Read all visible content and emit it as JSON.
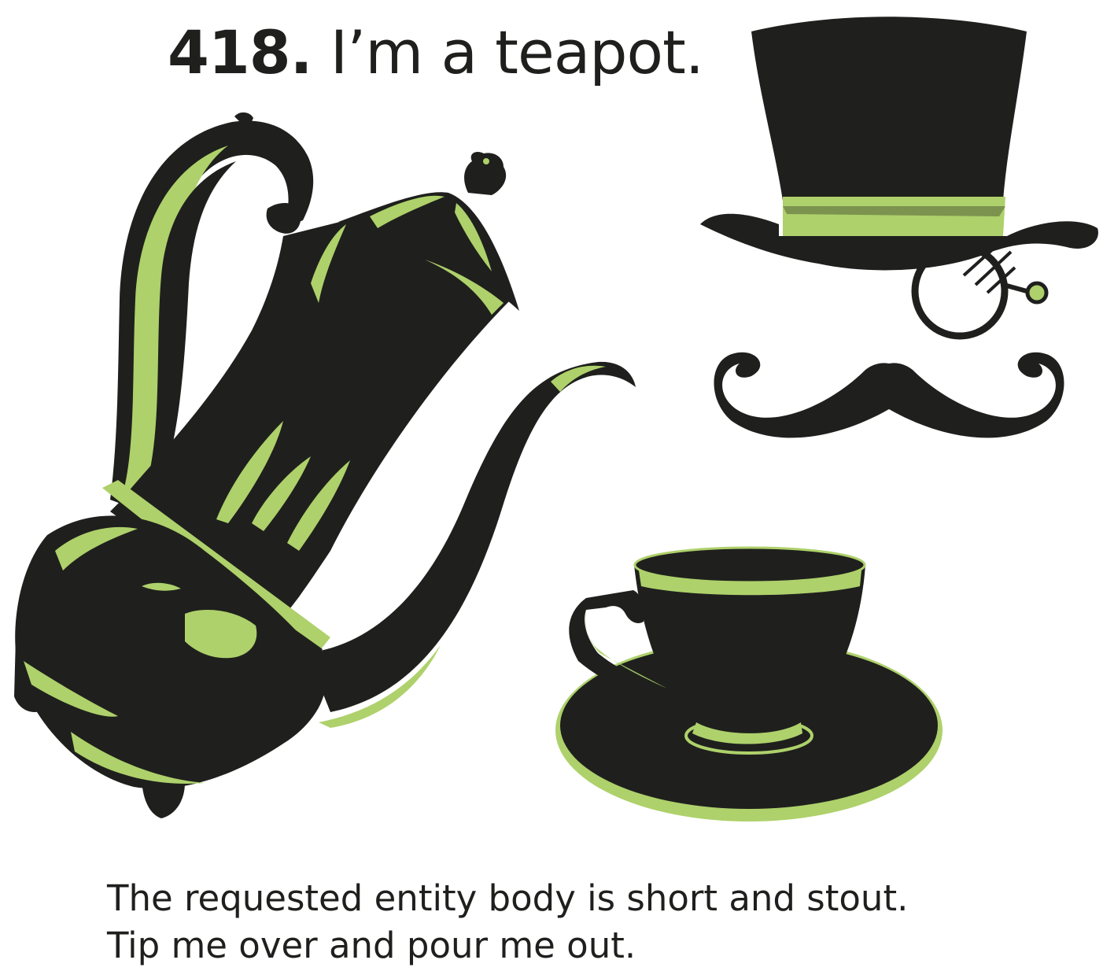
{
  "heading": {
    "code": "418.",
    "message": "I’m a teapot."
  },
  "caption": {
    "line1": "The requested entity body is short and stout.",
    "line2": "Tip me over and pour me out."
  },
  "colors": {
    "ink": "#1f201d",
    "accent": "#aed16b",
    "background": "#ffffff"
  },
  "icons": [
    "teapot-icon",
    "top-hat-icon",
    "monocle-icon",
    "mustache-icon",
    "teacup-icon",
    "saucer-icon"
  ]
}
